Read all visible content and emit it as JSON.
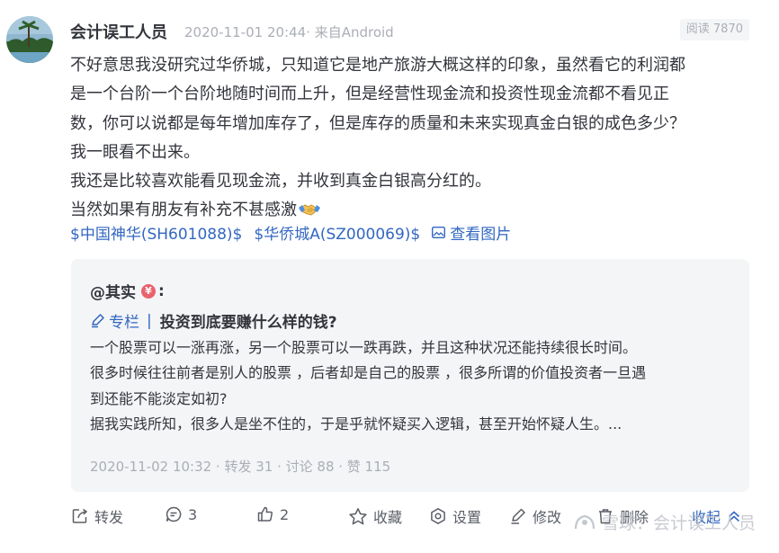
{
  "post": {
    "author": "会计误工人员",
    "meta": "2020-11-01 20:44· 来自Android",
    "views": "阅读 7870",
    "paragraphs": [
      "不好意思我没研究过华侨城，只知道它是地产旅游大概这样的印象，虽然看它的利润都",
      "是一个台阶一个台阶地随时间而上升，但是经营性现金流和投资性现金流都不看见正",
      "数，你可以说都是每年增加库存了，但是库存的质量和未来实现真金白银的成色多少？",
      "我一眼看不出来。",
      "我还是比较喜欢能看见现金流，并收到真金白银高分红的。",
      "当然如果有朋友有补充不甚感激"
    ],
    "stocks": [
      "$中国神华(SH601088)$",
      "$华侨城A(SZ000069)$"
    ],
    "view_image": "查看图片"
  },
  "quote": {
    "author": "@其实",
    "colon": ":",
    "column_label": "专栏",
    "separator": "|",
    "title": "投资到底要赚什么样的钱?",
    "lines": [
      "一个股票可以一涨再涨，另一个股票可以一跌再跌，并且这种状况还能持续很长时间。",
      "很多时候往往前者是别人的股票 ，后者却是自己的股票 ，很多所谓的价值投资者一旦遇",
      "到还能不能淡定如初?",
      "据我实践所知，很多人是坐不住的，于是乎就怀疑买入逻辑，甚至开始怀疑人生。..."
    ],
    "stats": "2020-11-02 10:32 · 转发 31 · 讨论 88 · 赞 115"
  },
  "actions": {
    "repost": "转发",
    "comments": "3",
    "likes": "2",
    "favorite": "收藏",
    "settings": "设置",
    "edit": "修改",
    "delete": "删除",
    "collapse": "收起"
  },
  "watermark": "雪球：会计误工人员",
  "colors": {
    "link": "#3267c1",
    "text": "#33353c",
    "muted": "#aaaeb6",
    "quote_bg": "#f4f5f7"
  },
  "icons": [
    "repost-icon",
    "comment-icon",
    "like-icon",
    "star-icon",
    "settings-icon",
    "edit-icon",
    "delete-icon",
    "chevron-up-icon",
    "image-icon",
    "pen-icon",
    "handshake-icon",
    "xueqiu-logo-icon"
  ]
}
